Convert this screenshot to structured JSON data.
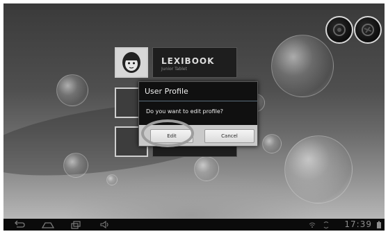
{
  "profiles": {
    "user_name": "LEXIBOOK",
    "user_subtitle": "Junior Tablet"
  },
  "dialog": {
    "title": "User Profile",
    "message": "Do you want to edit profile?",
    "edit_label": "Edit",
    "cancel_label": "Cancel"
  },
  "status_bar": {
    "time": "17:39"
  },
  "icons": {
    "back": "back-icon",
    "home": "home-icon",
    "recent": "recent-apps-icon",
    "volume_down": "volume-down-icon",
    "volume_up": "volume-up-icon"
  }
}
